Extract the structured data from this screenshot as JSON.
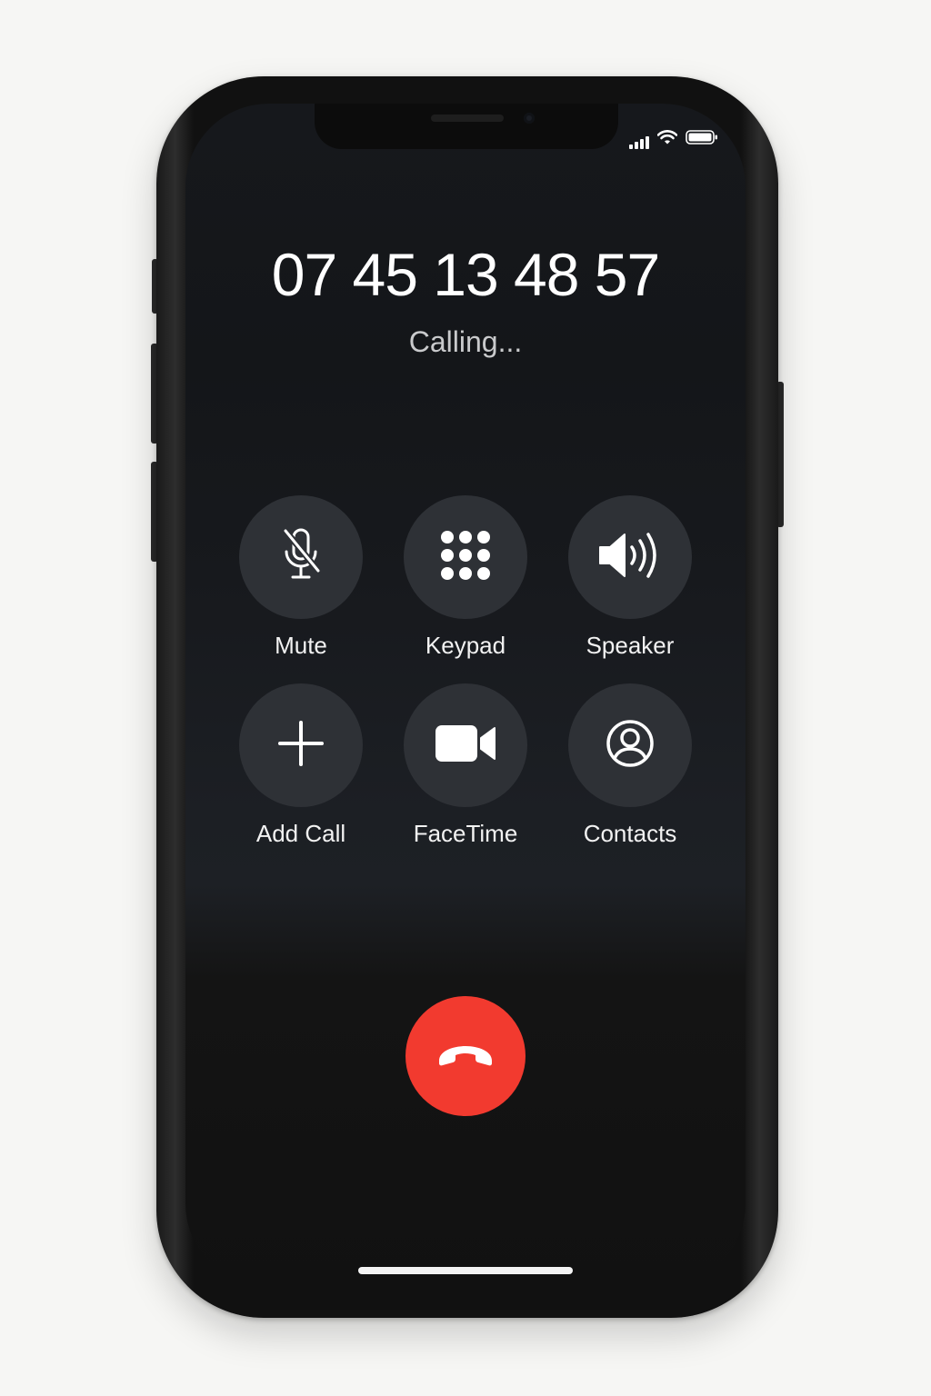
{
  "call": {
    "number": "07 45 13 48 57",
    "status": "Calling..."
  },
  "controls": [
    {
      "label": "Mute",
      "icon": "mic-slash-icon"
    },
    {
      "label": "Keypad",
      "icon": "keypad-icon"
    },
    {
      "label": "Speaker",
      "icon": "speaker-icon"
    },
    {
      "label": "Add Call",
      "icon": "plus-icon"
    },
    {
      "label": "FaceTime",
      "icon": "video-camera-icon"
    },
    {
      "label": "Contacts",
      "icon": "person-circle-icon"
    }
  ],
  "end_call": {
    "icon": "end-call-icon",
    "color": "#f23a2f"
  },
  "status_bar": {
    "icons": [
      "signal-icon",
      "wifi-icon",
      "battery-icon"
    ]
  },
  "colors": {
    "background": "#16181c",
    "control_circle": "#2e3136",
    "text": "#ffffff",
    "end_call": "#f23a2f"
  }
}
